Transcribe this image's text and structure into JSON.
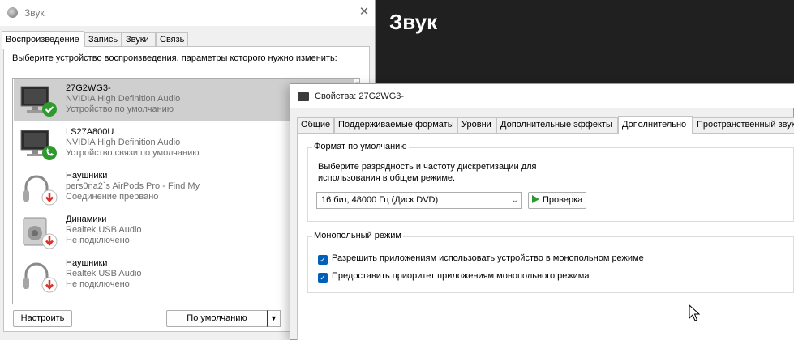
{
  "settings": {
    "title": "Звук"
  },
  "sound_dialog": {
    "title": "Звук",
    "tabs": [
      {
        "label": "Воспроизведение"
      },
      {
        "label": "Запись"
      },
      {
        "label": "Звуки"
      },
      {
        "label": "Связь"
      }
    ],
    "instruction": "Выберите устройство воспроизведения, параметры которого нужно изменить:",
    "devices": [
      {
        "name": "27G2WG3-",
        "driver": "NVIDIA High Definition Audio",
        "status": "Устройство по умолчанию",
        "icon": "monitor-icon",
        "badge": "check-badge-icon"
      },
      {
        "name": "LS27A800U",
        "driver": "NVIDIA High Definition Audio",
        "status": "Устройство связи по умолчанию",
        "icon": "monitor-icon",
        "badge": "phone-badge-icon"
      },
      {
        "name": "Наушники",
        "driver": "pers0na2`s AirPods Pro - Find My",
        "status": "Соединение прервано",
        "icon": "headphones-icon",
        "badge": "down-arrow-badge-icon"
      },
      {
        "name": "Динамики",
        "driver": "Realtek USB Audio",
        "status": "Не подключено",
        "icon": "speaker-icon",
        "badge": "down-arrow-badge-icon"
      },
      {
        "name": "Наушники",
        "driver": "Realtek USB Audio",
        "status": "Не подключено",
        "icon": "headphones-icon",
        "badge": "down-arrow-badge-icon"
      }
    ],
    "configure_button": "Настроить",
    "default_button": "По умолчанию"
  },
  "properties_dialog": {
    "title": "Свойства: 27G2WG3-",
    "tabs": [
      {
        "label": "Общие"
      },
      {
        "label": "Поддерживаемые форматы"
      },
      {
        "label": "Уровни"
      },
      {
        "label": "Дополнительные эффекты"
      },
      {
        "label": "Дополнительно"
      },
      {
        "label": "Пространственный звук"
      }
    ],
    "active_tab": "Дополнительно",
    "default_format": {
      "legend": "Формат по умолчанию",
      "description": "Выберите разрядность и частоту дискретизации для использования в общем режиме.",
      "selected_format": "16 бит, 48000 Гц (Диск DVD)",
      "test_button": "Проверка"
    },
    "exclusive_mode": {
      "legend": "Монопольный режим",
      "options": [
        {
          "label": "Разрешить приложениям использовать устройство в монопольном режиме",
          "checked": true
        },
        {
          "label": "Предоставить приоритет приложениям монопольного режима",
          "checked": true
        }
      ]
    }
  },
  "colors": {
    "accent_checkbox": "#005fb8",
    "status_green": "#2e9a2e",
    "status_red": "#d9342b",
    "settings_bg": "#202020"
  }
}
